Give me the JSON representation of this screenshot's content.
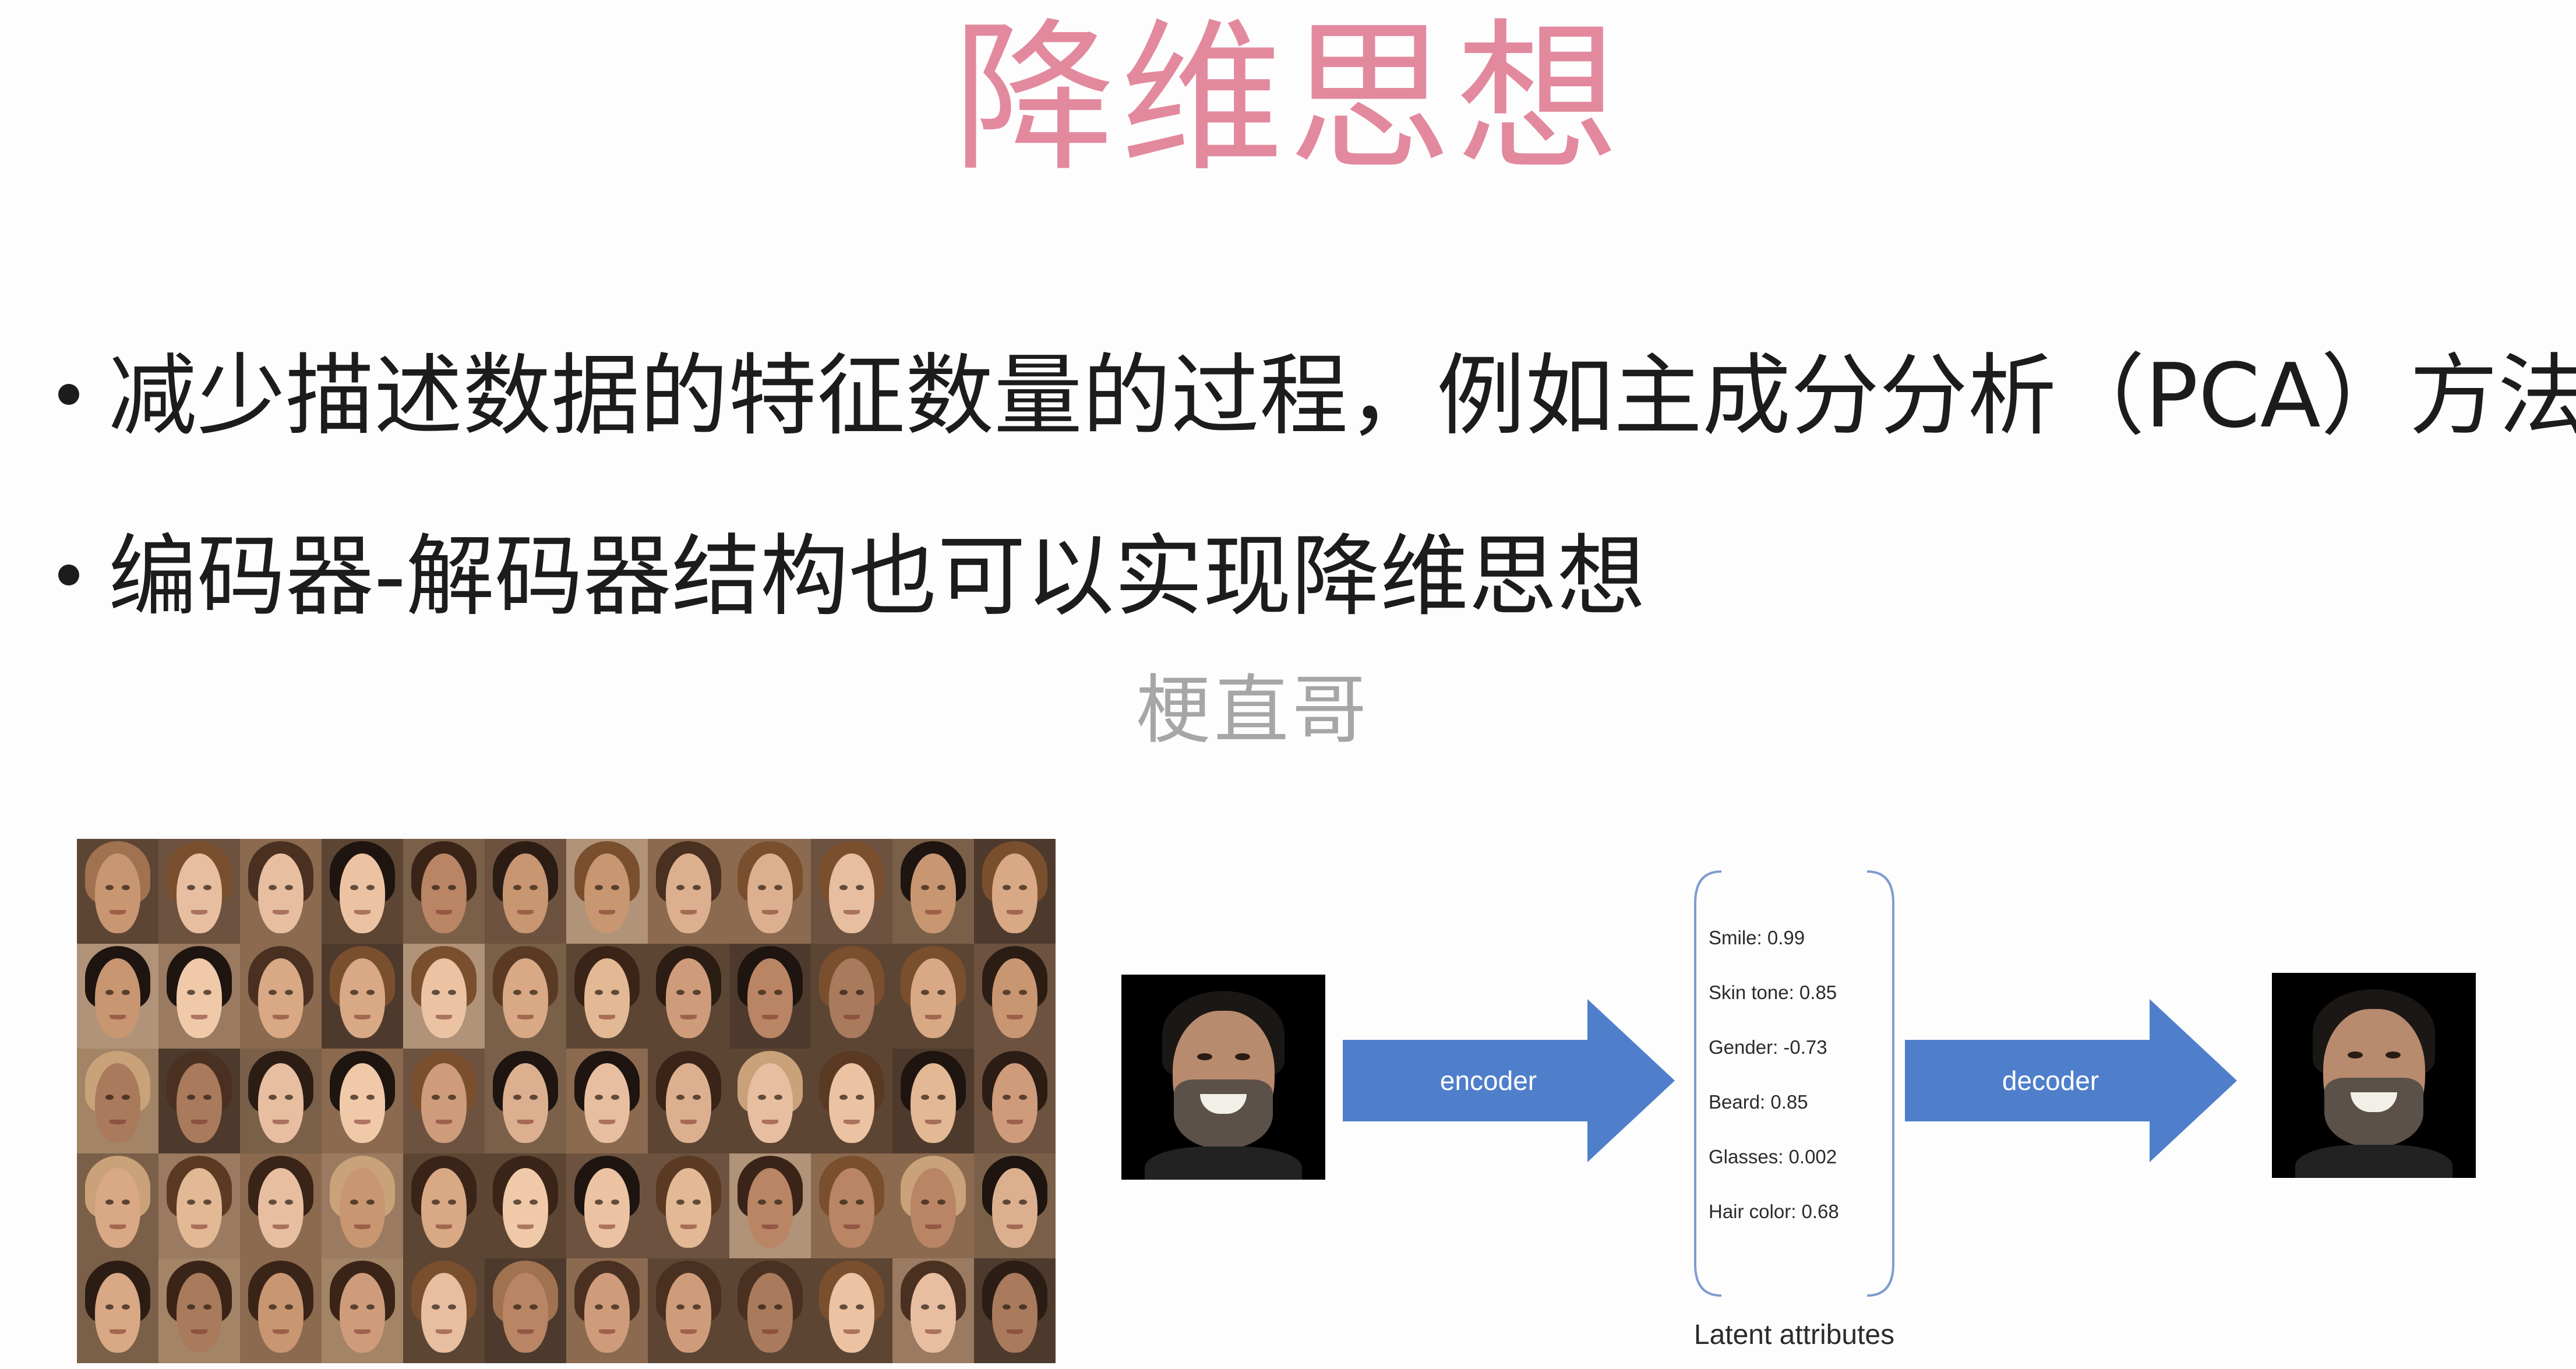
{
  "slide": {
    "title": "降维思想",
    "bullets": [
      "减少描述数据的特征数量的过程，例如主成分分析（PCA）方法",
      "编码器-解码器结构也可以实现降维思想"
    ],
    "watermark": "梗直哥"
  },
  "diagram": {
    "encoder_label": "encoder",
    "decoder_label": "decoder",
    "latent_attributes": [
      "Smile: 0.99",
      "Skin tone: 0.85",
      "Gender: -0.73",
      "Beard: 0.85",
      "Glasses: 0.002",
      "Hair color: 0.68"
    ],
    "latent_caption": "Latent attributes",
    "arrow_color": "#4f7fcb"
  },
  "colors": {
    "title": "#e3899e",
    "text": "#1c1c1c",
    "watermark": "#a6a6a6"
  }
}
